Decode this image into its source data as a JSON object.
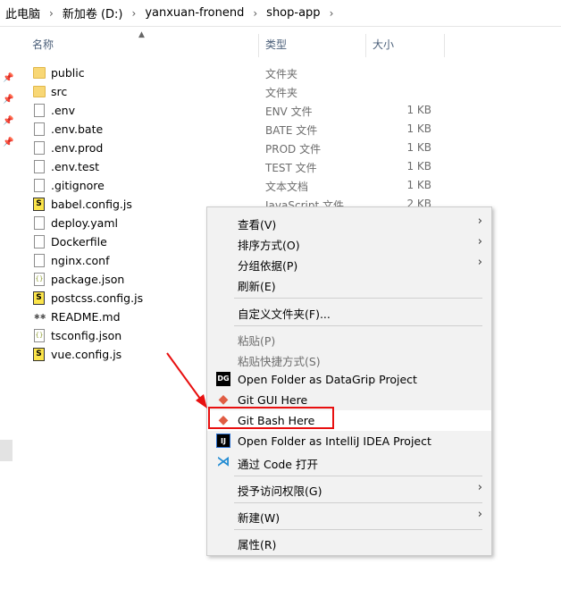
{
  "breadcrumb": [
    "此电脑",
    "新加卷 (D:)",
    "yanxuan-fronend",
    "shop-app"
  ],
  "columns": {
    "name": "名称",
    "type": "类型",
    "size": "大小"
  },
  "files": [
    {
      "name": "public",
      "type": "文件夹",
      "size": "",
      "icon": "folder-icon"
    },
    {
      "name": "src",
      "type": "文件夹",
      "size": "",
      "icon": "folder-icon"
    },
    {
      "name": ".env",
      "type": "ENV 文件",
      "size": "1 KB",
      "icon": "file-icon"
    },
    {
      "name": ".env.bate",
      "type": "BATE 文件",
      "size": "1 KB",
      "icon": "file-icon"
    },
    {
      "name": ".env.prod",
      "type": "PROD 文件",
      "size": "1 KB",
      "icon": "file-icon"
    },
    {
      "name": ".env.test",
      "type": "TEST 文件",
      "size": "1 KB",
      "icon": "file-icon"
    },
    {
      "name": ".gitignore",
      "type": "文本文档",
      "size": "1 KB",
      "icon": "text-file-icon"
    },
    {
      "name": "babel.config.js",
      "type": "JavaScript 文件",
      "size": "2 KB",
      "icon": "js-file-icon"
    },
    {
      "name": "deploy.yaml",
      "type": "",
      "size": "",
      "icon": "file-icon"
    },
    {
      "name": "Dockerfile",
      "type": "",
      "size": "",
      "icon": "file-icon"
    },
    {
      "name": "nginx.conf",
      "type": "",
      "size": "",
      "icon": "file-icon"
    },
    {
      "name": "package.json",
      "type": "",
      "size": "",
      "icon": "json-file-icon"
    },
    {
      "name": "postcss.config.js",
      "type": "",
      "size": "",
      "icon": "js-file-icon"
    },
    {
      "name": "README.md",
      "type": "",
      "size": "",
      "icon": "markdown-file-icon"
    },
    {
      "name": "tsconfig.json",
      "type": "",
      "size": "",
      "icon": "json-file-icon"
    },
    {
      "name": "vue.config.js",
      "type": "",
      "size": "",
      "icon": "js-file-icon"
    }
  ],
  "context_menu": {
    "view": "查看(V)",
    "sort": "排序方式(O)",
    "group": "分组依据(P)",
    "refresh": "刷新(E)",
    "customize": "自定义文件夹(F)...",
    "paste": "粘贴(P)",
    "paste_shortcut": "粘贴快捷方式(S)",
    "datagrip": "Open Folder as DataGrip Project",
    "datagrip_icon_text": "DG",
    "git_gui": "Git GUI Here",
    "git_bash": "Git Bash Here",
    "idea": "Open Folder as IntelliJ IDEA Project",
    "idea_icon_text": "IJ",
    "vscode": "通过 Code 打开",
    "grant_access": "授予访问权限(G)",
    "new": "新建(W)",
    "properties": "属性(R)"
  },
  "colors": {
    "highlight_border": "#e81010",
    "annotation_arrow": "#e81010"
  }
}
